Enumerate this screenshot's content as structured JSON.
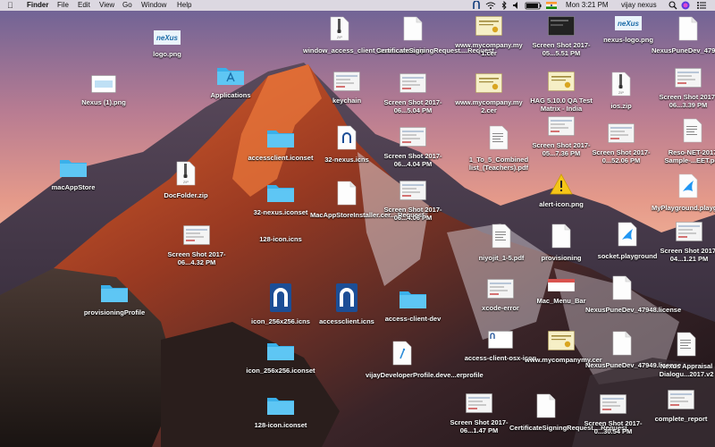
{
  "menubar": {
    "app_name": "Finder",
    "items": [
      "File",
      "Edit",
      "View",
      "Go",
      "Window",
      "Help"
    ],
    "clock": "Mon 3:21 PM",
    "user": "vijay nexus"
  },
  "icons": [
    {
      "name": "logo.png",
      "kind": "nexus"
    },
    {
      "name": "Nexus (1).png",
      "kind": "nexuslogo"
    },
    {
      "name": "Applications",
      "kind": "appfolder"
    },
    {
      "name": "macAppStore",
      "kind": "folder"
    },
    {
      "name": "DocFolder.zip",
      "kind": "zip"
    },
    {
      "name": "window_access_client_scre....shot.zip",
      "kind": "zip"
    },
    {
      "name": "keychain",
      "kind": "shot"
    },
    {
      "name": "accessclient.iconset",
      "kind": "folder"
    },
    {
      "name": "32-nexus.iconset",
      "kind": "folder"
    },
    {
      "name": "32-nexus.icns",
      "kind": "icnsdoc"
    },
    {
      "name": "MacAppStoreInstaller.cer....Request",
      "kind": "doc"
    },
    {
      "name": "CertificateSigningRequest....Request",
      "kind": "doc"
    },
    {
      "name": "Screen Shot 2017-06...5.04 PM",
      "kind": "shot"
    },
    {
      "name": "Screen Shot 2017-06...4.04 PM",
      "kind": "shot"
    },
    {
      "name": "Screen Shot 2017-06...4.06 PM",
      "kind": "shot"
    },
    {
      "name": "Screen Shot 2017-06...4.32 PM",
      "kind": "shot"
    },
    {
      "name": "128-icon.icns",
      "kind": "none"
    },
    {
      "name": "provisioningProfile",
      "kind": "folder"
    },
    {
      "name": "icon_256x256.icns",
      "kind": "icns"
    },
    {
      "name": "accessclient.icns",
      "kind": "icns"
    },
    {
      "name": "access-client-dev",
      "kind": "folder"
    },
    {
      "name": "icon_256x256.iconset",
      "kind": "folder"
    },
    {
      "name": "vijayDeveloperProfile.deve...erprofile",
      "kind": "profile"
    },
    {
      "name": "128-icon.iconset",
      "kind": "folder"
    },
    {
      "name": "www.mycompany.my 1.cer",
      "kind": "cert"
    },
    {
      "name": "www.mycompany.my 2.cer",
      "kind": "cert"
    },
    {
      "name": "1_To_5_Combined list_(Teachers).pdf",
      "kind": "pdf"
    },
    {
      "name": "niyojit_1-5.pdf",
      "kind": "pdf"
    },
    {
      "name": "xcode-error",
      "kind": "shot"
    },
    {
      "name": "access-client-osx-icon",
      "kind": "nexusdoc"
    },
    {
      "name": "Screen Shot 2017-06...1.47 PM",
      "kind": "shot"
    },
    {
      "name": "CertificateSigningRequest....Request",
      "kind": "doc"
    },
    {
      "name": "www.mycompanymy.cer",
      "kind": "cert"
    },
    {
      "name": "Screen Shot 2017-0...30.54 PM",
      "kind": "shot"
    },
    {
      "name": "Screen Shot 2017-05...5.51 PM",
      "kind": "darkshot"
    },
    {
      "name": "HAG 5.10.0 QA Test Matrix - India",
      "kind": "cert"
    },
    {
      "name": "Screen Shot 2017-05...7.36 PM",
      "kind": "shot"
    },
    {
      "name": "alert-icon.png",
      "kind": "alert"
    },
    {
      "name": "provisioning",
      "kind": "doc"
    },
    {
      "name": "Mac_Menu_Bar",
      "kind": "menubar"
    },
    {
      "name": "nexus-logo.png",
      "kind": "nexus"
    },
    {
      "name": "ios.zip",
      "kind": "zip"
    },
    {
      "name": "Screen Shot 2017-0...52.06 PM",
      "kind": "shot"
    },
    {
      "name": "socket.playground",
      "kind": "swift"
    },
    {
      "name": "NexusPuneDev_47948.license",
      "kind": "doc"
    },
    {
      "name": "NexusPuneDev_47949.license",
      "kind": "doc"
    },
    {
      "name": "NexusPuneDev_47947.license",
      "kind": "doc"
    },
    {
      "name": "Screen Shot 2017-06...3.39 PM",
      "kind": "shot"
    },
    {
      "name": "Reso-NET-2017 Sample-...EET.pdf",
      "kind": "pdf"
    },
    {
      "name": "MyPlayground.playground",
      "kind": "swift"
    },
    {
      "name": "Screen Shot 2017-04...1.21 PM",
      "kind": "shot"
    },
    {
      "name": "Nexus Appraisal Dialogu...2017.v2",
      "kind": "pdf"
    },
    {
      "name": "complete_report",
      "kind": "shot"
    }
  ]
}
